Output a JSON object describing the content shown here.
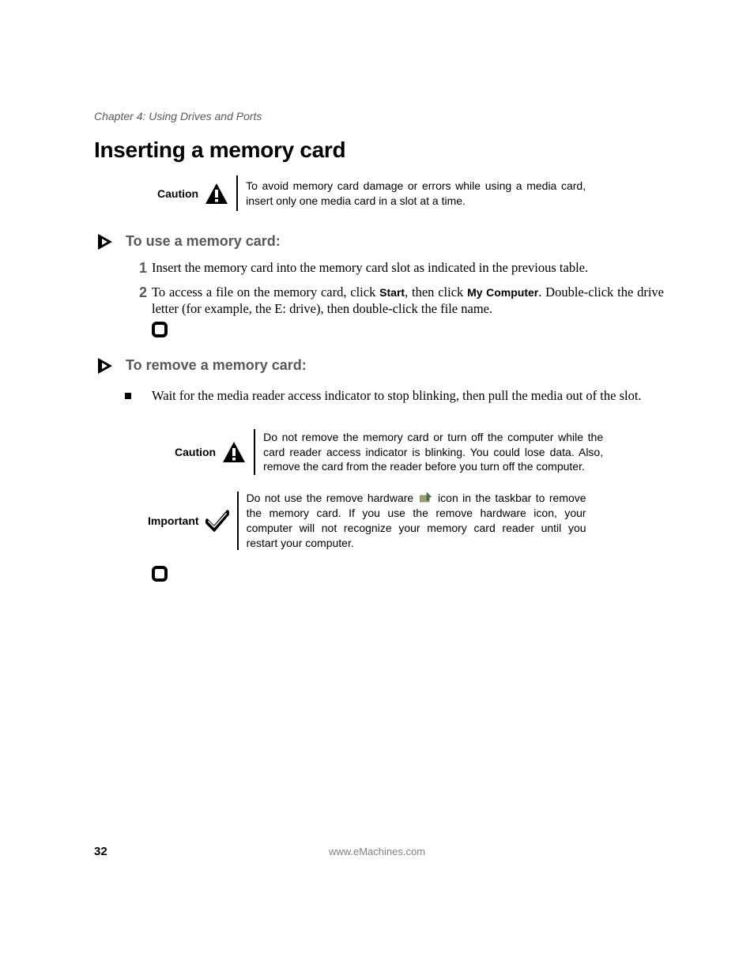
{
  "chapter": "Chapter 4: Using Drives and Ports",
  "heading": "Inserting a memory card",
  "callout1": {
    "label": "Caution",
    "text": "To avoid memory card damage or errors while using a media card, insert only one media card in a slot at a time."
  },
  "section1": {
    "title": "To use a memory card:",
    "steps": [
      {
        "num": "1",
        "text": "Insert the memory card into the memory card slot as indicated in the previous table."
      },
      {
        "num": "2",
        "pre": "To access a file on the memory card, click ",
        "b1": "Start",
        "mid": ", then click ",
        "b2": "My Computer",
        "post": ". Double-click the drive letter (for example, the E: drive), then double-click the file name."
      }
    ]
  },
  "section2": {
    "title": "To remove a memory card:",
    "item": "Wait for the media reader access indicator to stop blinking, then pull the media out of the slot."
  },
  "callout2": {
    "label": "Caution",
    "text": "Do not remove the memory card or turn off the computer while the card reader access indicator is blinking. You could lose data. Also, remove the card from the reader before you turn off the computer."
  },
  "callout3": {
    "label": "Important",
    "pre": "Do not use the remove hardware ",
    "post": " icon in the taskbar to remove the memory card. If you use the remove hardware icon, your computer will not recognize your memory card reader until you restart your computer."
  },
  "pageNumber": "32",
  "footer": "www.eMachines.com"
}
